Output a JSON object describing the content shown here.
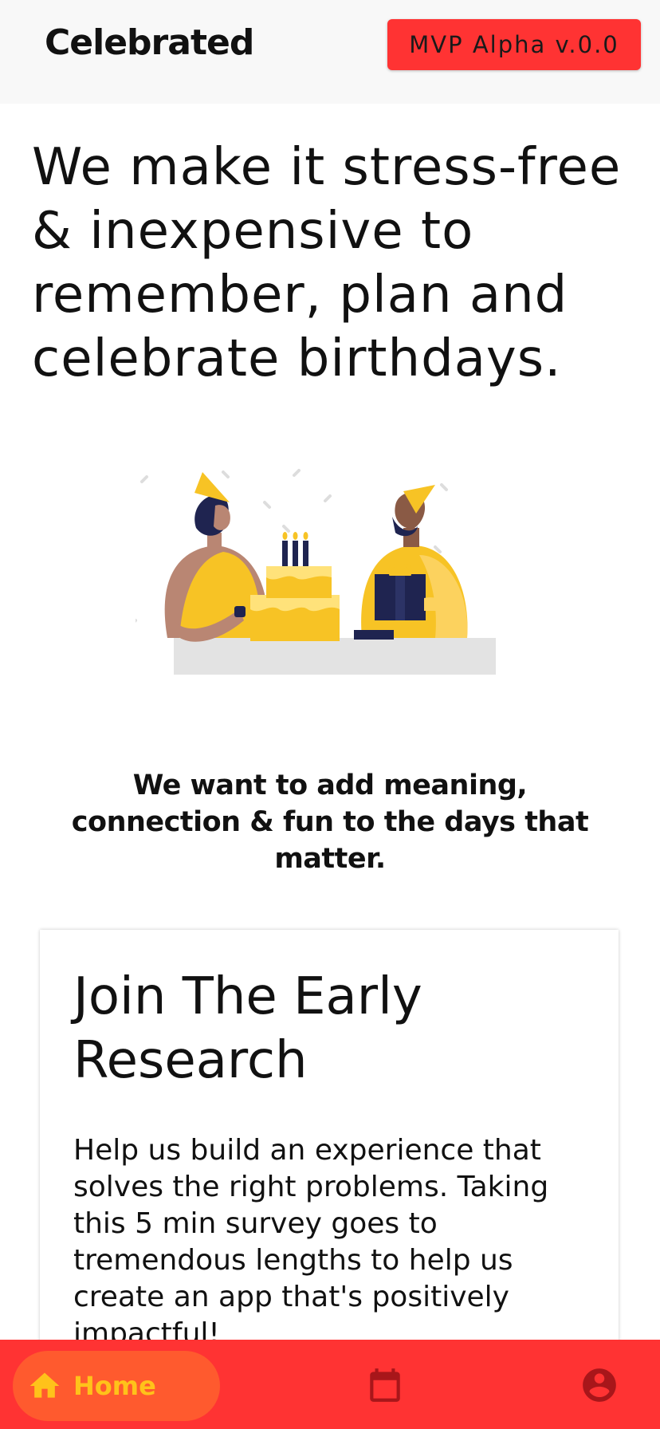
{
  "app": {
    "title": "Celebrated",
    "version_label": "MVP Alpha v.0.0"
  },
  "hero": {
    "heading": "We make it stress-free & inexpensive to remember, plan and celebrate birthdays.",
    "illustration_icon": "birthday-celebration-illustration"
  },
  "mission": {
    "text": "We want to add meaning, connection & fun to the days that matter."
  },
  "card": {
    "title": "Join The Early Research",
    "body": "Help us build an experience that solves the right problems. Taking this 5 min survey goes to tremendous lengths to help us create an app that's positively impactful!"
  },
  "bottom_nav": {
    "items": [
      {
        "label": "Home",
        "icon": "home-icon",
        "active": true
      },
      {
        "label": "",
        "icon": "calendar-icon",
        "active": false
      },
      {
        "label": "",
        "icon": "account-circle-icon",
        "active": false
      }
    ]
  },
  "colors": {
    "accent": "#ff3333",
    "nav_active_bg": "#ff5a2e",
    "nav_active_fg": "#ffc21a",
    "nav_icon": "#a8161a",
    "appbar_bg": "#f8f8f8",
    "illustration_yellow": "#f7c325",
    "illustration_navy": "#1f2450"
  }
}
